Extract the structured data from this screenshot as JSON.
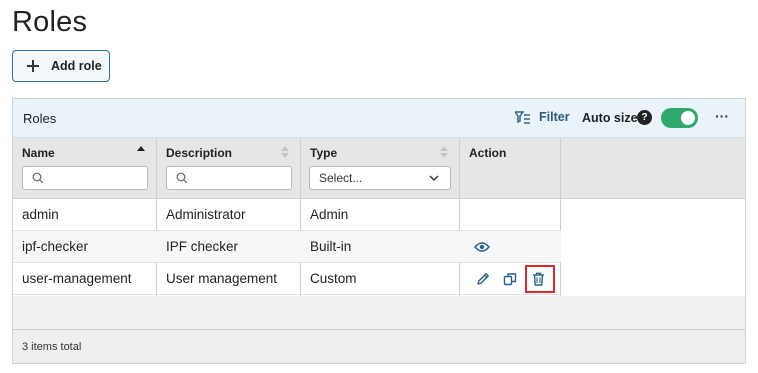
{
  "page": {
    "title": "Roles"
  },
  "toolbar": {
    "add_label": "Add role"
  },
  "grid": {
    "title": "Roles",
    "filter_label": "Filter",
    "autosize_label": "Auto size",
    "help_glyph": "?",
    "more_glyph": "···",
    "autosize_on": true,
    "columns": [
      {
        "label": "Name",
        "sort": "asc"
      },
      {
        "label": "Description",
        "sort": "none"
      },
      {
        "label": "Type",
        "sort": "none"
      },
      {
        "label": "Action"
      }
    ],
    "type_placeholder": "Select...",
    "rows": [
      {
        "name": "admin",
        "description": "Administrator",
        "type": "Admin",
        "actions": []
      },
      {
        "name": "ipf-checker",
        "description": "IPF checker",
        "type": "Built-in",
        "actions": [
          "view-icon"
        ]
      },
      {
        "name": "user-management",
        "description": "User management",
        "type": "Custom",
        "actions": [
          "edit-icon",
          "copy-icon",
          "delete-icon"
        ]
      }
    ],
    "footer_text": "3 items total"
  },
  "colors": {
    "accent": "#2d5f84",
    "toggle_on": "#2eaa6e",
    "highlight": "#e0262b"
  }
}
